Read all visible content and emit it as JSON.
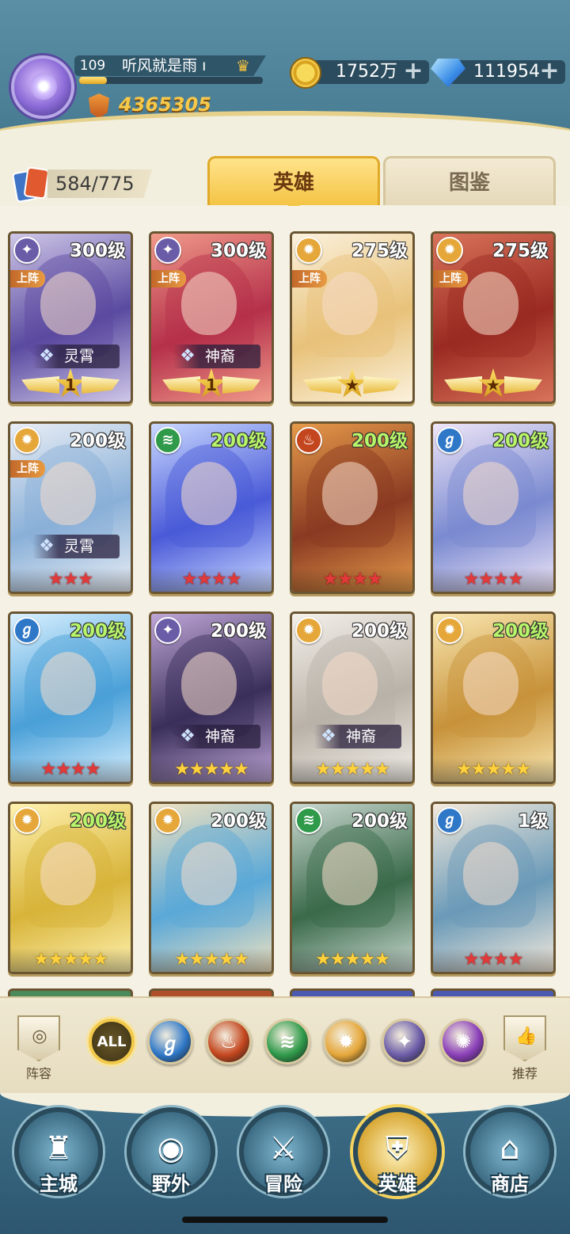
{
  "player": {
    "level": "109",
    "name": "听风就是雨",
    "name_suffix": "ı",
    "exp_fraction": 0.15,
    "power": "4365305"
  },
  "resources": {
    "gold": "1752万",
    "gems": "111954",
    "plus": "+"
  },
  "collection": {
    "count": "584/775"
  },
  "tabs": {
    "heroes": "英雄",
    "codex": "图鉴"
  },
  "colors": {
    "faction_light": "#e6a73a",
    "faction_dark": "#6b5ca8",
    "faction_water": "#2f78c8",
    "faction_fire": "#c4461e",
    "faction_wind": "#2f9a4a",
    "faction_arcane": "#8a3fb8"
  },
  "heroes": [
    {
      "faction": "dark",
      "icon": "✦",
      "level": "300级",
      "level_green": false,
      "deploy": "上阵",
      "title": "灵霄",
      "stars": "",
      "star_color": "gold",
      "wing_badge": "1",
      "palette": [
        "#5a4aa0",
        "#cfc7e8"
      ]
    },
    {
      "faction": "dark",
      "icon": "✦",
      "level": "300级",
      "level_green": false,
      "deploy": "上阵",
      "title": "神裔",
      "stars": "",
      "star_color": "gold",
      "wing_badge": "1",
      "palette": [
        "#b5304a",
        "#f09a8a"
      ]
    },
    {
      "faction": "light",
      "icon": "✹",
      "level": "275级",
      "level_green": false,
      "deploy": "上阵",
      "title": "",
      "stars": "",
      "star_color": "gold",
      "wing_badge": "★",
      "palette": [
        "#e8c27a",
        "#fbf1dc"
      ]
    },
    {
      "faction": "light",
      "icon": "✹",
      "level": "275级",
      "level_green": false,
      "deploy": "上阵",
      "title": "",
      "stars": "",
      "star_color": "gold",
      "wing_badge": "★",
      "palette": [
        "#9a2a22",
        "#d9735a"
      ]
    },
    {
      "faction": "light",
      "icon": "✹",
      "level": "200级",
      "level_green": false,
      "deploy": "上阵",
      "title": "灵霄",
      "stars": "★★★",
      "star_color": "red",
      "wing_badge": "",
      "palette": [
        "#8ab0d8",
        "#e9eef5"
      ]
    },
    {
      "faction": "wind",
      "icon": "≋",
      "level": "200级",
      "level_green": true,
      "deploy": "",
      "title": "",
      "stars": "★★★★",
      "star_color": "red",
      "wing_badge": "",
      "palette": [
        "#4a5ad8",
        "#c9d8ff"
      ]
    },
    {
      "faction": "fire",
      "icon": "♨",
      "level": "200级",
      "level_green": true,
      "deploy": "",
      "title": "",
      "stars": "★★★★",
      "star_color": "red",
      "wing_badge": "",
      "palette": [
        "#8a3a22",
        "#e59a4a"
      ]
    },
    {
      "faction": "water",
      "icon": "ℊ",
      "level": "200级",
      "level_green": true,
      "deploy": "",
      "title": "",
      "stars": "★★★★",
      "star_color": "red",
      "wing_badge": "",
      "palette": [
        "#7a8ad0",
        "#efe6f8"
      ]
    },
    {
      "faction": "water",
      "icon": "ℊ",
      "level": "200级",
      "level_green": true,
      "deploy": "",
      "title": "",
      "stars": "★★★★",
      "star_color": "red",
      "wing_badge": "",
      "palette": [
        "#4aa0d8",
        "#d8f0ff"
      ]
    },
    {
      "faction": "dark",
      "icon": "✦",
      "level": "200级",
      "level_green": false,
      "deploy": "",
      "title": "神裔",
      "stars": "★★★★★",
      "star_color": "gold",
      "wing_badge": "",
      "palette": [
        "#3a2f5a",
        "#bfa6d8"
      ]
    },
    {
      "faction": "light",
      "icon": "✹",
      "level": "200级",
      "level_green": false,
      "deploy": "",
      "title": "神裔",
      "stars": "★★★★★",
      "star_color": "gold",
      "wing_badge": "",
      "palette": [
        "#b9b2a8",
        "#f4f0ea"
      ]
    },
    {
      "faction": "light",
      "icon": "✹",
      "level": "200级",
      "level_green": true,
      "deploy": "",
      "title": "",
      "stars": "★★★★★",
      "star_color": "gold",
      "wing_badge": "",
      "palette": [
        "#c7923a",
        "#f9e7b0"
      ]
    },
    {
      "faction": "light",
      "icon": "✹",
      "level": "200级",
      "level_green": true,
      "deploy": "",
      "title": "",
      "stars": "★★★★★",
      "star_color": "gold",
      "wing_badge": "",
      "palette": [
        "#d8b43a",
        "#fff2b0"
      ]
    },
    {
      "faction": "light",
      "icon": "✹",
      "level": "200级",
      "level_green": false,
      "deploy": "",
      "title": "",
      "stars": "★★★★★",
      "star_color": "gold",
      "wing_badge": "",
      "palette": [
        "#5aa8d8",
        "#f0e2c0"
      ]
    },
    {
      "faction": "wind",
      "icon": "≋",
      "level": "200级",
      "level_green": false,
      "deploy": "",
      "title": "",
      "stars": "★★★★★",
      "star_color": "gold",
      "wing_badge": "",
      "palette": [
        "#3a6a4a",
        "#c9d8d0"
      ]
    },
    {
      "faction": "water",
      "icon": "ℊ",
      "level": "1级",
      "level_green": false,
      "deploy": "",
      "title": "",
      "stars": "★★★★",
      "star_color": "red",
      "wing_badge": "",
      "palette": [
        "#6a9ab8",
        "#f4eadc"
      ]
    }
  ],
  "filters": {
    "lineup_label": "阵容",
    "recommend_label": "推荐",
    "factions": [
      {
        "id": "all",
        "label": "ALL"
      },
      {
        "id": "water",
        "label": "ℊ"
      },
      {
        "id": "fire",
        "label": "♨"
      },
      {
        "id": "wind",
        "label": "≋"
      },
      {
        "id": "light",
        "label": "✹"
      },
      {
        "id": "dark",
        "label": "✦"
      },
      {
        "id": "arcane",
        "label": "✺"
      }
    ]
  },
  "nav": [
    {
      "id": "main-city",
      "label": "主城",
      "art": "♜"
    },
    {
      "id": "wild",
      "label": "野外",
      "art": "◉"
    },
    {
      "id": "adventure",
      "label": "冒险",
      "art": "⚔"
    },
    {
      "id": "heroes",
      "label": "英雄",
      "art": "⛨"
    },
    {
      "id": "shop",
      "label": "商店",
      "art": "⌂"
    }
  ]
}
